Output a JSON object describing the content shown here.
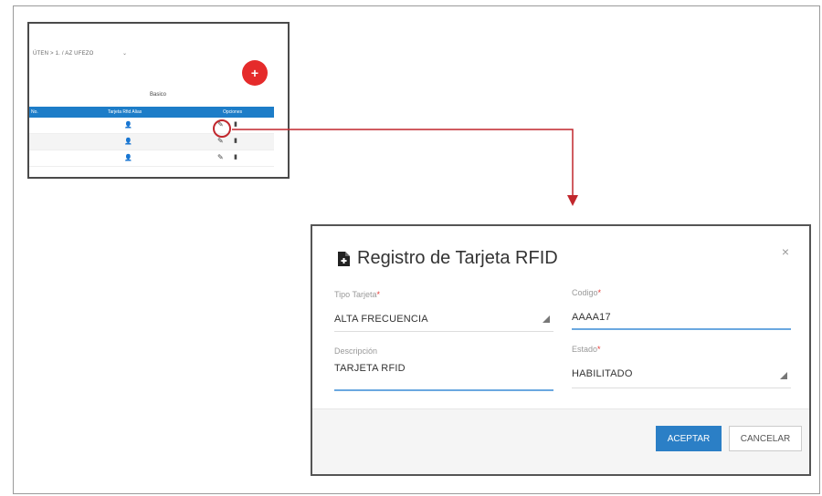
{
  "thumbnail": {
    "breadcrumb": "ÚTEN > 1. / AZ UFEZO",
    "caret": "⌄",
    "fab_label": "+",
    "caption": "Basico",
    "table_headers": [
      "No.",
      "Tarjeta Rfid Alias",
      "Opciones"
    ],
    "rows": [
      {
        "person": "👤",
        "edit": "✎",
        "trash": "▮"
      },
      {
        "person": "👤",
        "edit": "✎",
        "trash": "▮"
      },
      {
        "person": "👤",
        "edit": "✎",
        "trash": "▮"
      }
    ]
  },
  "dialog": {
    "title": "Registro de Tarjeta RFID",
    "close": "×",
    "fields": {
      "tipo_tarjeta": {
        "label": "Tipo Tarjeta",
        "required": "*",
        "value": "ALTA FRECUENCIA"
      },
      "codigo": {
        "label": "Codigo",
        "required": "*",
        "value": "AAAA17"
      },
      "descripcion": {
        "label": "Descripción",
        "value": "TARJETA RFID"
      },
      "estado": {
        "label": "Estado",
        "required": "*",
        "value": "HABILITADO"
      }
    },
    "accept_label": "ACEPTAR",
    "cancel_label": "CANCELAR"
  },
  "colors": {
    "accent": "#2b7fc6",
    "fab": "#e52b2b",
    "arrow": "#c1272d",
    "active_underline": "#6aa8e0"
  }
}
